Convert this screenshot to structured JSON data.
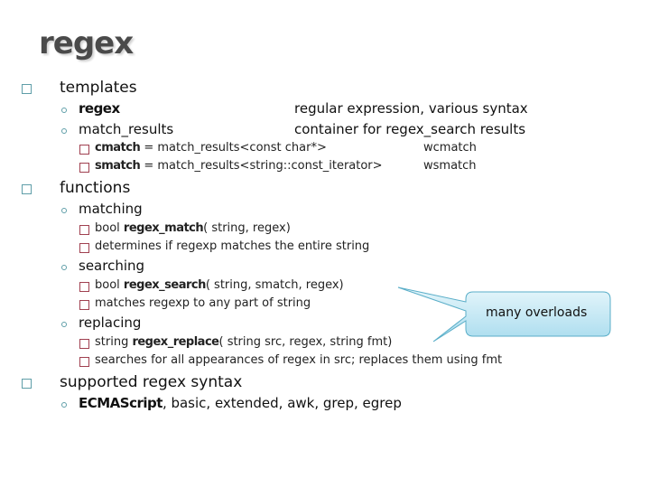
{
  "title": "regex",
  "sections": {
    "templates": {
      "label": "templates",
      "items": {
        "regex": {
          "name": "regex",
          "desc": "regular expression, various syntax"
        },
        "match_results": {
          "name": "match_results",
          "desc": "container for regex_search results"
        }
      },
      "subitems": {
        "cmatch": {
          "name": "cmatch",
          "def": " = match_results<const char*>",
          "wide": "wcmatch"
        },
        "smatch": {
          "name": "smatch",
          "def": " = match_results<string::const_iterator>",
          "wide": "wsmatch"
        }
      }
    },
    "functions": {
      "label": "functions",
      "matching": {
        "label": "matching",
        "sig_prefix": "bool ",
        "sig_name": "regex_match",
        "sig_args": "( string, regex)",
        "desc": "determines if regexp matches the entire string"
      },
      "searching": {
        "label": "searching",
        "sig_prefix": "bool ",
        "sig_name": "regex_search",
        "sig_args": "( string, smatch, regex)",
        "desc": "matches regexp to any part of string"
      },
      "replacing": {
        "label": "replacing",
        "sig_prefix": "string ",
        "sig_name": "regex_replace",
        "sig_args": "( string src, regex, string fmt)",
        "desc": "searches for all appearances of regex in src; replaces them using fmt"
      }
    },
    "syntax": {
      "label": "supported regex syntax",
      "bold": "ECMAScript",
      "rest": ", basic, extended, awk, grep, egrep"
    }
  },
  "callout": {
    "text": "many overloads",
    "fill": "#bfe6f3",
    "stroke": "#5aaec8"
  },
  "colors": {
    "title": "#4a4a4a",
    "bullet_level1": "#5f9ea8",
    "bullet_level3": "#a04050"
  }
}
